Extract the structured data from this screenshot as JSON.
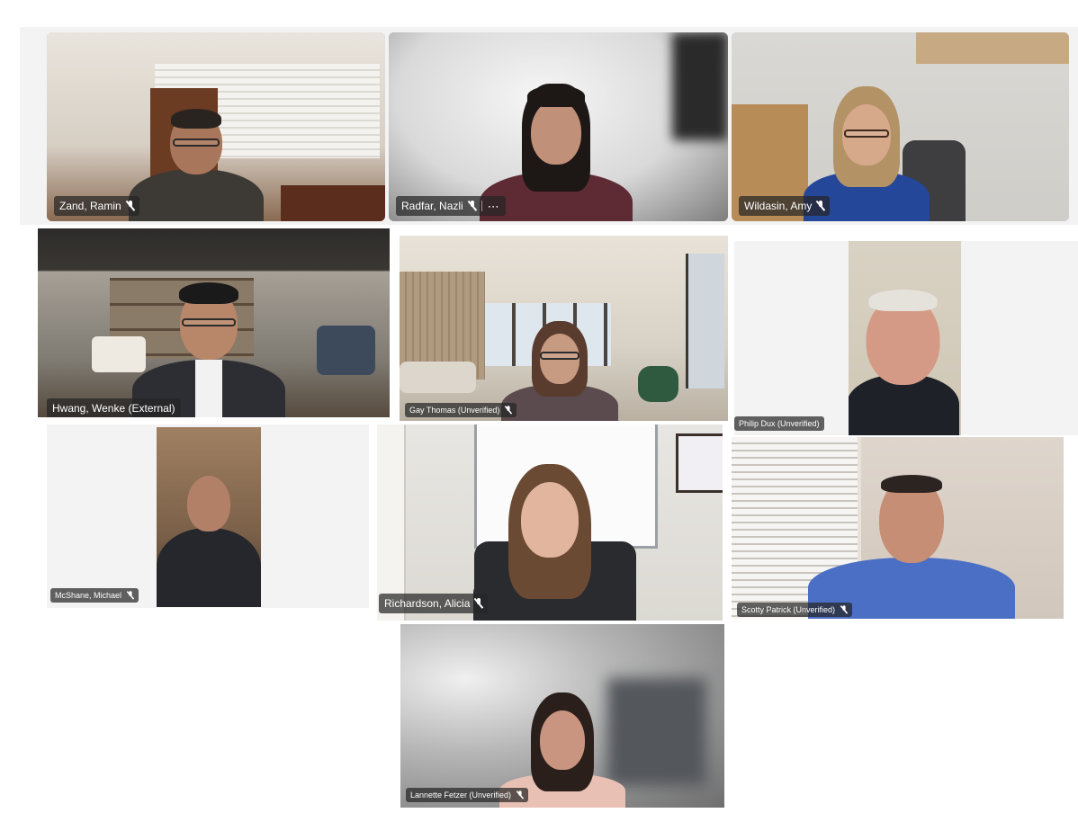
{
  "meeting": {
    "participants": [
      {
        "name": "Zand, Ramin",
        "mic": "mic-off-icon"
      },
      {
        "name": "Radfar, Nazli",
        "mic": "mic-off-icon",
        "extra": "more-icon"
      },
      {
        "name": "Wildasin, Amy",
        "mic": "mic-off-icon"
      },
      {
        "name": "Hwang, Wenke (External)"
      },
      {
        "name": "Gay Thomas (Unverified)",
        "mic": "mic-off-icon"
      },
      {
        "name": "Philip Dux (Unverified)"
      },
      {
        "name": "McShane, Michael",
        "mic": "mic-off-icon"
      },
      {
        "name": "Richardson, Alicia",
        "mic": "mic-off-icon"
      },
      {
        "name": "Scotty Patrick (Unverified)",
        "mic": "mic-off-icon"
      },
      {
        "name": "Lannette Fetzer (Unverified)",
        "mic": "mic-off-icon"
      }
    ]
  },
  "colors": {
    "nametag_bg": "#262626",
    "page_bg": "#ffffff",
    "strip_bg": "#f3f3f3"
  }
}
